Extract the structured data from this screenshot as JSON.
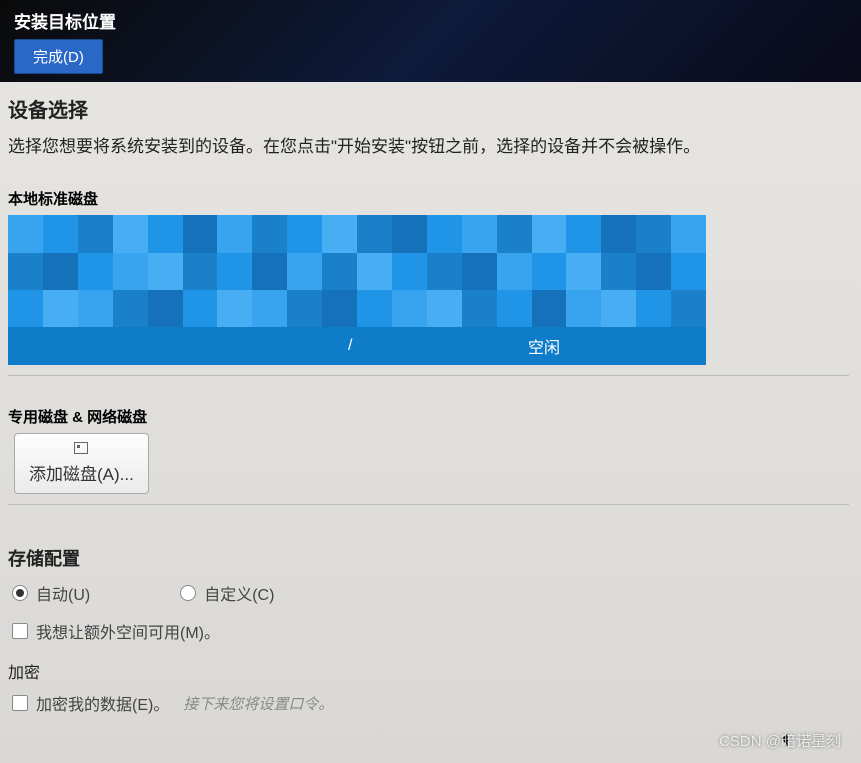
{
  "header": {
    "title": "安装目标位置",
    "done_button": "完成(D)"
  },
  "device_selection": {
    "title": "设备选择",
    "description": "选择您想要将系统安装到的设备。在您点击\"开始安装\"按钮之前，选择的设备并不会被操作。"
  },
  "local_disks": {
    "title": "本地标准磁盘",
    "selected_disk": {
      "separator": "/",
      "free_label": "空闲"
    }
  },
  "special_disks": {
    "title": "专用磁盘 & 网络磁盘",
    "add_button": "添加磁盘(A)..."
  },
  "storage_config": {
    "title": "存储配置",
    "auto_label": "自动(U)",
    "custom_label": "自定义(C)",
    "extra_space_label": "我想让额外空间可用(M)。"
  },
  "encryption": {
    "title": "加密",
    "encrypt_label": "加密我的数据(E)。",
    "hint": "接下来您将设置口令。"
  },
  "watermark": "CSDN @暗诺星刻"
}
